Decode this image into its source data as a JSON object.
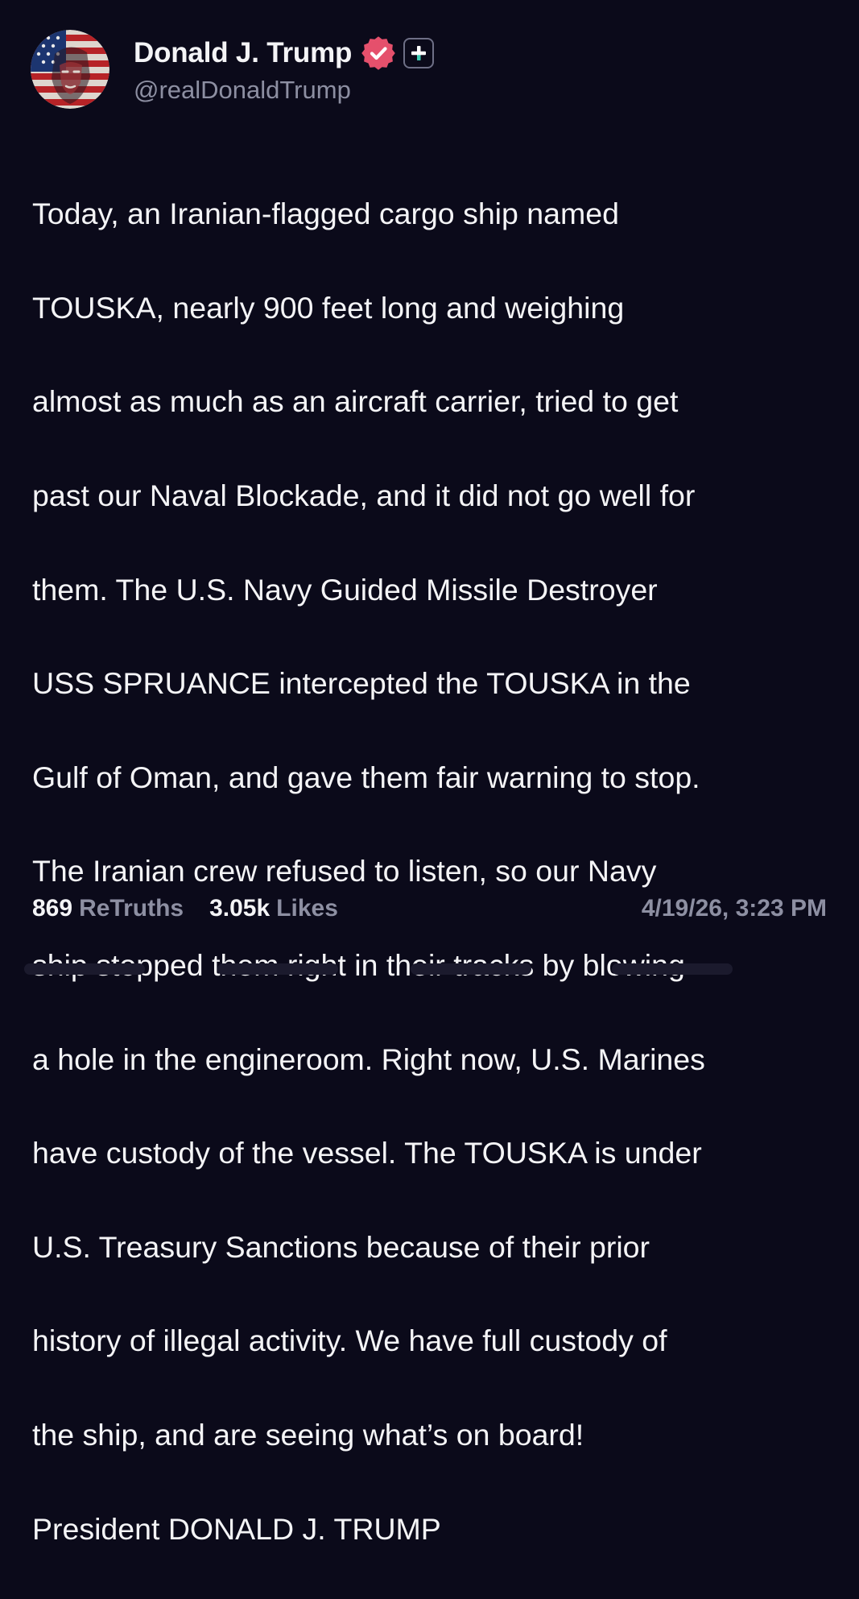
{
  "author": {
    "display_name": "Donald J. Trump",
    "handle": "@realDonaldTrump",
    "verified_icon": "verified-badge-icon",
    "verified_color": "#e5506c",
    "plus_icon": "plus-icon"
  },
  "post": {
    "lines": [
      "Today, an Iranian-flagged cargo ship named",
      "TOUSKA, nearly 900 feet long and weighing",
      "almost as much as an aircraft carrier, tried to get",
      "past our Naval Blockade, and it did not go well for",
      "them. The U.S. Navy Guided Missile Destroyer",
      "USS SPRUANCE intercepted the TOUSKA in the",
      "Gulf of Oman, and gave them fair warning to stop.",
      "The Iranian crew refused to listen, so our Navy",
      "ship stopped them right in their tracks by blowing",
      "a hole in the engineroom. Right now, U.S. Marines",
      "have custody of the vessel. The TOUSKA is under",
      "U.S. Treasury Sanctions because of their prior",
      "history of illegal activity. We have full custody of",
      "the ship, and are seeing what’s on board!",
      "President DONALD J. TRUMP"
    ]
  },
  "stats": {
    "retruths_count": "869",
    "retruths_label": "ReTruths",
    "likes_count": "3.05k",
    "likes_label": "Likes"
  },
  "timestamp": "4/19/26, 3:23 PM",
  "colors": {
    "background": "#0b0a1a",
    "text": "#f4f4f6",
    "muted": "#8d8fa2",
    "accent": "#e5506c"
  }
}
